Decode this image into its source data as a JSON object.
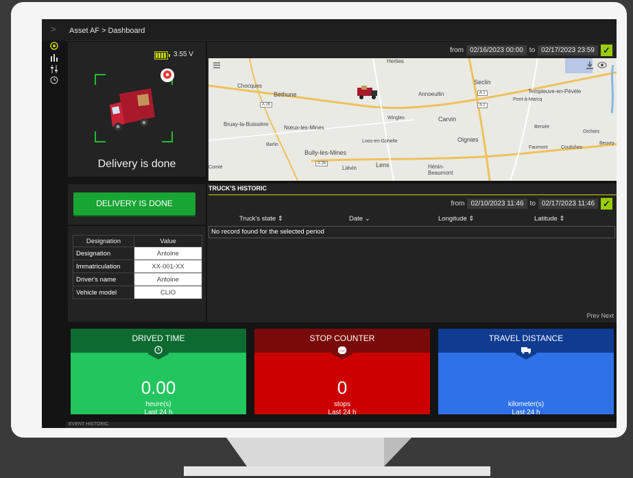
{
  "breadcrumb": "Asset AF > Dashboard",
  "nav": {
    "icons": [
      "asset-icon",
      "chart-bars-icon",
      "sliders-icon",
      "clock-icon"
    ]
  },
  "status": {
    "voltage": "3.55 V",
    "battery_level": 1.0,
    "message": "Delivery is done"
  },
  "delivery_button": "DELIVERY IS DONE",
  "info_table": {
    "headers": [
      "Designation",
      "Value"
    ],
    "rows": [
      {
        "key": "Designation",
        "value": "Antoine"
      },
      {
        "key": "Immatriculation",
        "value": "XX-001-XX"
      },
      {
        "key": "Driver's name",
        "value": "Antoine"
      },
      {
        "key": "Vehicle model",
        "value": "CLIO"
      }
    ]
  },
  "map_panel": {
    "from_label": "from",
    "to_label": "to",
    "from": "02/16/2023 00:00",
    "to": "02/17/2023 23:59"
  },
  "map_labels": {
    "chocques": "Chocques",
    "bethune": "Béthune",
    "annoeullin": "Annoeullin",
    "seclin": "Seclin",
    "templeuve": "Templeuve-en-Pévèle",
    "pont": "Pont-à-Marcq",
    "wingles": "Wingles",
    "carvin": "Carvin",
    "bruay": "Bruay-la-Buissière",
    "noeux": "Nœux-les-Mines",
    "barlin": "Barlin",
    "loos": "Loos-en-Gohelle",
    "bully": "Bully-les-Mines",
    "oignies": "Oignies",
    "bersee": "Bersée",
    "orchies": "Orchies",
    "beuvry": "Beuvry",
    "faumont": "Faumont",
    "coutiches": "Coutiches",
    "comte": "Comté",
    "lievin": "Liévin",
    "lens": "Lens",
    "henin": "Hénin-Beaumont",
    "herlies": "Herlies",
    "a26a": "A 26",
    "a26b": "A 26",
    "a1a": "A 1",
    "a1b": "A 1"
  },
  "historic": {
    "title": "TRUCK'S HISTORIC",
    "from_label": "from",
    "to_label": "to",
    "from": "02/10/2023 11:46",
    "to": "02/17/2023 11:46",
    "columns": [
      "Truck's state ⇕",
      "Date ⌄",
      "Longitude ⇕",
      "Latitude ⇕"
    ],
    "empty_message": "No record found for the selected period",
    "prev": "Prev",
    "next": "Next"
  },
  "cards": [
    {
      "title": "DRIVED TIME",
      "value": "0.00",
      "unit": "heure(s)",
      "period": "Last 24 h",
      "header_color": "#0d6b32",
      "body_color": "#22c55e",
      "icon": "clock-icon"
    },
    {
      "title": "STOP COUNTER",
      "value": "0",
      "unit": "stops",
      "period": "Last 24 h",
      "header_color": "#7a0a0a",
      "body_color": "#cc0000",
      "icon": "stop-sign-icon"
    },
    {
      "title": "TRAVEL DISTANCE",
      "value": "",
      "unit": "kilometer(s)",
      "period": "Last 24 h",
      "header_color": "#0f3c91",
      "body_color": "#2f72e8",
      "icon": "truck-icon"
    }
  ],
  "stop_icon_text": "STOP",
  "bottom_strip": "EVENT HISTORIC"
}
